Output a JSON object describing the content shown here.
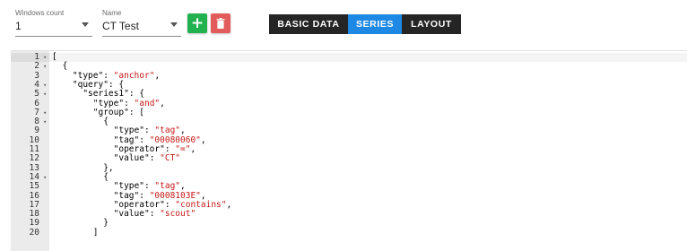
{
  "toolbar": {
    "windows_count": {
      "label": "Windows count",
      "value": "1"
    },
    "name": {
      "label": "Name",
      "value": "CT Test"
    },
    "add_button": {
      "icon": "plus-icon",
      "color": "#21b24f",
      "glyph": "+"
    },
    "delete_button": {
      "icon": "trash-icon",
      "color": "#e35c5c"
    },
    "tabs": [
      {
        "label": "BASIC DATA",
        "active": false
      },
      {
        "label": "SERIES",
        "active": true
      },
      {
        "label": "LAYOUT",
        "active": false
      }
    ],
    "accent": "#1e88e5"
  },
  "editor": {
    "lines": [
      {
        "n": "1",
        "fold": true,
        "tokens": [
          [
            "p",
            "["
          ]
        ]
      },
      {
        "n": "2",
        "fold": true,
        "tokens": [
          [
            "p",
            "  {"
          ]
        ]
      },
      {
        "n": "3",
        "fold": false,
        "tokens": [
          [
            "p",
            "    "
          ],
          [
            "k",
            "\"type\""
          ],
          [
            "p",
            ": "
          ],
          [
            "s",
            "\"anchor\""
          ],
          [
            "p",
            ","
          ]
        ]
      },
      {
        "n": "4",
        "fold": true,
        "tokens": [
          [
            "p",
            "    "
          ],
          [
            "k",
            "\"query\""
          ],
          [
            "p",
            ": {"
          ]
        ]
      },
      {
        "n": "5",
        "fold": true,
        "tokens": [
          [
            "p",
            "      "
          ],
          [
            "k",
            "\"series1\""
          ],
          [
            "p",
            ": {"
          ]
        ]
      },
      {
        "n": "6",
        "fold": false,
        "tokens": [
          [
            "p",
            "        "
          ],
          [
            "k",
            "\"type\""
          ],
          [
            "p",
            ": "
          ],
          [
            "s",
            "\"and\""
          ],
          [
            "p",
            ","
          ]
        ]
      },
      {
        "n": "7",
        "fold": true,
        "tokens": [
          [
            "p",
            "        "
          ],
          [
            "k",
            "\"group\""
          ],
          [
            "p",
            ": ["
          ]
        ]
      },
      {
        "n": "8",
        "fold": true,
        "tokens": [
          [
            "p",
            "          {"
          ]
        ]
      },
      {
        "n": "9",
        "fold": false,
        "tokens": [
          [
            "p",
            "            "
          ],
          [
            "k",
            "\"type\""
          ],
          [
            "p",
            ": "
          ],
          [
            "s",
            "\"tag\""
          ],
          [
            "p",
            ","
          ]
        ]
      },
      {
        "n": "10",
        "fold": false,
        "tokens": [
          [
            "p",
            "            "
          ],
          [
            "k",
            "\"tag\""
          ],
          [
            "p",
            ": "
          ],
          [
            "s",
            "\"00080060\""
          ],
          [
            "p",
            ","
          ]
        ]
      },
      {
        "n": "11",
        "fold": false,
        "tokens": [
          [
            "p",
            "            "
          ],
          [
            "k",
            "\"operator\""
          ],
          [
            "p",
            ": "
          ],
          [
            "s",
            "\"=\""
          ],
          [
            "p",
            ","
          ]
        ]
      },
      {
        "n": "12",
        "fold": false,
        "tokens": [
          [
            "p",
            "            "
          ],
          [
            "k",
            "\"value\""
          ],
          [
            "p",
            ": "
          ],
          [
            "s",
            "\"CT\""
          ]
        ]
      },
      {
        "n": "13",
        "fold": false,
        "tokens": [
          [
            "p",
            "          },"
          ]
        ]
      },
      {
        "n": "14",
        "fold": true,
        "tokens": [
          [
            "p",
            "          {"
          ]
        ]
      },
      {
        "n": "15",
        "fold": false,
        "tokens": [
          [
            "p",
            "            "
          ],
          [
            "k",
            "\"type\""
          ],
          [
            "p",
            ": "
          ],
          [
            "s",
            "\"tag\""
          ],
          [
            "p",
            ","
          ]
        ]
      },
      {
        "n": "16",
        "fold": false,
        "tokens": [
          [
            "p",
            "            "
          ],
          [
            "k",
            "\"tag\""
          ],
          [
            "p",
            ": "
          ],
          [
            "s",
            "\"0008103E\""
          ],
          [
            "p",
            ","
          ]
        ]
      },
      {
        "n": "17",
        "fold": false,
        "tokens": [
          [
            "p",
            "            "
          ],
          [
            "k",
            "\"operator\""
          ],
          [
            "p",
            ": "
          ],
          [
            "s",
            "\"contains\""
          ],
          [
            "p",
            ","
          ]
        ]
      },
      {
        "n": "18",
        "fold": false,
        "tokens": [
          [
            "p",
            "            "
          ],
          [
            "k",
            "\"value\""
          ],
          [
            "p",
            ": "
          ],
          [
            "s",
            "\"scout\""
          ]
        ]
      },
      {
        "n": "19",
        "fold": false,
        "tokens": [
          [
            "p",
            "          }"
          ]
        ]
      },
      {
        "n": "20",
        "fold": false,
        "tokens": [
          [
            "p",
            "        ]"
          ]
        ]
      }
    ],
    "active_line": "1"
  }
}
